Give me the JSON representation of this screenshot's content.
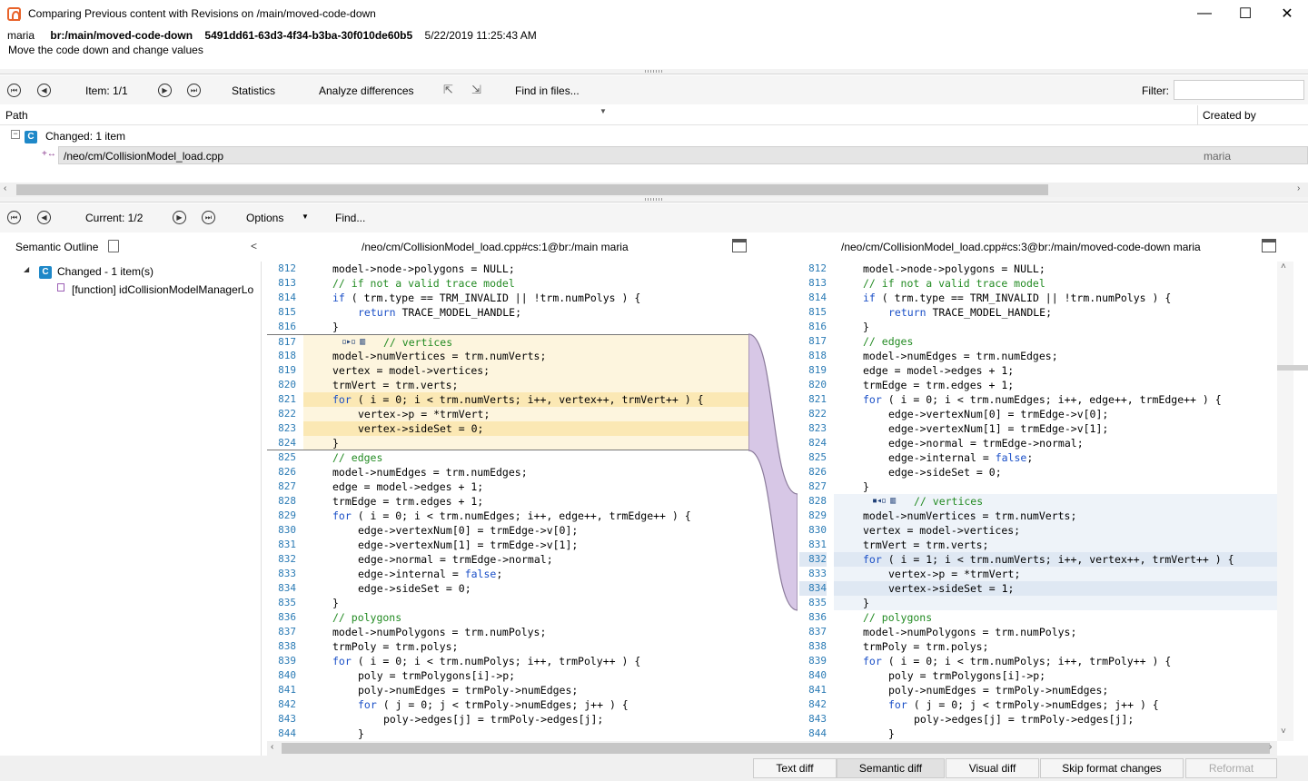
{
  "window": {
    "title": "Comparing Previous content with Revisions on /main/moved-code-down",
    "minimize": "—",
    "maximize": "☐",
    "close": "✕"
  },
  "changeset": {
    "user": "maria",
    "branch": "br:/main/moved-code-down",
    "guid": "5491dd61-63d3-4f34-b3ba-30f010de60b5",
    "date": "5/22/2019 11:25:43 AM",
    "comment": "Move the code down and change values"
  },
  "toolbar1": {
    "item_label": "Item: 1/1",
    "statistics": "Statistics",
    "analyze": "Analyze differences",
    "find_files": "Find in files...",
    "filter_label": "Filter:",
    "filter_value": ""
  },
  "list": {
    "col_path": "Path",
    "col_created": "Created by",
    "group_badge": "C",
    "group_label": "Changed: 1 item",
    "expander": "−",
    "item_icon": "+↔",
    "item_path": "/neo/cm/CollisionModel_load.cpp",
    "item_creator": "maria"
  },
  "toolbar2": {
    "current_label": "Current: 1/2",
    "options": "Options",
    "find": "Find..."
  },
  "outline": {
    "title": "Semantic Outline",
    "collapse": "<",
    "root_badge": "C",
    "root_label": "Changed - 1 item(s)",
    "child_label": "[function] idCollisionModelManagerLo"
  },
  "left_panel": {
    "title": "/neo/cm/CollisionModel_load.cpp#cs:1@br:/main maria"
  },
  "right_panel": {
    "title": "/neo/cm/CollisionModel_load.cpp#cs:3@br:/main/moved-code-down maria"
  },
  "left_code": [
    {
      "n": "812",
      "t": "model->node->polygons = NULL;",
      "i": 0,
      "c": "n"
    },
    {
      "n": "813",
      "t": "// if not a valid trace model",
      "i": 0,
      "c": "c"
    },
    {
      "n": "814",
      "t": "if ( trm.type == TRM_INVALID || !trm.numPolys ) {",
      "i": 0,
      "c": "n"
    },
    {
      "n": "815",
      "t": "return TRACE_MODEL_HANDLE;",
      "i": 1,
      "c": "n"
    },
    {
      "n": "816",
      "t": "}",
      "i": 0,
      "c": "n"
    },
    {
      "n": "817",
      "t": "// vertices",
      "i": 0,
      "c": "c",
      "h": "m"
    },
    {
      "n": "818",
      "t": "model->numVertices = trm.numVerts;",
      "i": 0,
      "c": "n",
      "h": "m"
    },
    {
      "n": "819",
      "t": "vertex = model->vertices;",
      "i": 0,
      "c": "n",
      "h": "m"
    },
    {
      "n": "820",
      "t": "trmVert = trm.verts;",
      "i": 0,
      "c": "n",
      "h": "m"
    },
    {
      "n": "821",
      "t": "for ( i = 0; i < trm.numVerts; i++, vertex++, trmVert++ ) {",
      "i": 0,
      "c": "n",
      "h": "s"
    },
    {
      "n": "822",
      "t": "vertex->p = *trmVert;",
      "i": 1,
      "c": "n",
      "h": "m"
    },
    {
      "n": "823",
      "t": "vertex->sideSet = 0;",
      "i": 1,
      "c": "n",
      "h": "s"
    },
    {
      "n": "824",
      "t": "}",
      "i": 0,
      "c": "n",
      "h": "m"
    },
    {
      "n": "825",
      "t": "// edges",
      "i": 0,
      "c": "c"
    },
    {
      "n": "826",
      "t": "model->numEdges = trm.numEdges;",
      "i": 0,
      "c": "n"
    },
    {
      "n": "827",
      "t": "edge = model->edges + 1;",
      "i": 0,
      "c": "n"
    },
    {
      "n": "828",
      "t": "trmEdge = trm.edges + 1;",
      "i": 0,
      "c": "n"
    },
    {
      "n": "829",
      "t": "for ( i = 0; i < trm.numEdges; i++, edge++, trmEdge++ ) {",
      "i": 0,
      "c": "n"
    },
    {
      "n": "830",
      "t": "edge->vertexNum[0] = trmEdge->v[0];",
      "i": 1,
      "c": "n"
    },
    {
      "n": "831",
      "t": "edge->vertexNum[1] = trmEdge->v[1];",
      "i": 1,
      "c": "n"
    },
    {
      "n": "832",
      "t": "edge->normal = trmEdge->normal;",
      "i": 1,
      "c": "n"
    },
    {
      "n": "833",
      "t": "edge->internal = false;",
      "i": 1,
      "c": "n"
    },
    {
      "n": "834",
      "t": "edge->sideSet = 0;",
      "i": 1,
      "c": "n"
    },
    {
      "n": "835",
      "t": "}",
      "i": 0,
      "c": "n"
    },
    {
      "n": "836",
      "t": "// polygons",
      "i": 0,
      "c": "c"
    },
    {
      "n": "837",
      "t": "model->numPolygons = trm.numPolys;",
      "i": 0,
      "c": "n"
    },
    {
      "n": "838",
      "t": "trmPoly = trm.polys;",
      "i": 0,
      "c": "n"
    },
    {
      "n": "839",
      "t": "for ( i = 0; i < trm.numPolys; i++, trmPoly++ ) {",
      "i": 0,
      "c": "n"
    },
    {
      "n": "840",
      "t": "poly = trmPolygons[i]->p;",
      "i": 1,
      "c": "n"
    },
    {
      "n": "841",
      "t": "poly->numEdges = trmPoly->numEdges;",
      "i": 1,
      "c": "n"
    },
    {
      "n": "842",
      "t": "for ( j = 0; j < trmPoly->numEdges; j++ ) {",
      "i": 1,
      "c": "n"
    },
    {
      "n": "843",
      "t": "poly->edges[j] = trmPoly->edges[j];",
      "i": 2,
      "c": "n"
    },
    {
      "n": "844",
      "t": "}",
      "i": 1,
      "c": "n"
    }
  ],
  "right_code": [
    {
      "n": "812",
      "t": "model->node->polygons = NULL;",
      "i": 0,
      "c": "n"
    },
    {
      "n": "813",
      "t": "// if not a valid trace model",
      "i": 0,
      "c": "c"
    },
    {
      "n": "814",
      "t": "if ( trm.type == TRM_INVALID || !trm.numPolys ) {",
      "i": 0,
      "c": "n"
    },
    {
      "n": "815",
      "t": "return TRACE_MODEL_HANDLE;",
      "i": 1,
      "c": "n"
    },
    {
      "n": "816",
      "t": "}",
      "i": 0,
      "c": "n"
    },
    {
      "n": "817",
      "t": "// edges",
      "i": 0,
      "c": "c"
    },
    {
      "n": "818",
      "t": "model->numEdges = trm.numEdges;",
      "i": 0,
      "c": "n"
    },
    {
      "n": "819",
      "t": "edge = model->edges + 1;",
      "i": 0,
      "c": "n"
    },
    {
      "n": "820",
      "t": "trmEdge = trm.edges + 1;",
      "i": 0,
      "c": "n"
    },
    {
      "n": "821",
      "t": "for ( i = 0; i < trm.numEdges; i++, edge++, trmEdge++ ) {",
      "i": 0,
      "c": "n"
    },
    {
      "n": "822",
      "t": "edge->vertexNum[0] = trmEdge->v[0];",
      "i": 1,
      "c": "n"
    },
    {
      "n": "823",
      "t": "edge->vertexNum[1] = trmEdge->v[1];",
      "i": 1,
      "c": "n"
    },
    {
      "n": "824",
      "t": "edge->normal = trmEdge->normal;",
      "i": 1,
      "c": "n"
    },
    {
      "n": "825",
      "t": "edge->internal = false;",
      "i": 1,
      "c": "n"
    },
    {
      "n": "826",
      "t": "edge->sideSet = 0;",
      "i": 1,
      "c": "n"
    },
    {
      "n": "827",
      "t": "}",
      "i": 0,
      "c": "n"
    },
    {
      "n": "828",
      "t": "// vertices",
      "i": 0,
      "c": "c",
      "h": "m"
    },
    {
      "n": "829",
      "t": "model->numVertices = trm.numVerts;",
      "i": 0,
      "c": "n",
      "h": "m"
    },
    {
      "n": "830",
      "t": "vertex = model->vertices;",
      "i": 0,
      "c": "n",
      "h": "m"
    },
    {
      "n": "831",
      "t": "trmVert = trm.verts;",
      "i": 0,
      "c": "n",
      "h": "m"
    },
    {
      "n": "832",
      "t": "for ( i = 1; i < trm.numVerts; i++, vertex++, trmVert++ ) {",
      "i": 0,
      "c": "n",
      "h": "s"
    },
    {
      "n": "833",
      "t": "vertex->p = *trmVert;",
      "i": 1,
      "c": "n",
      "h": "m"
    },
    {
      "n": "834",
      "t": "vertex->sideSet = 1;",
      "i": 1,
      "c": "n",
      "h": "s"
    },
    {
      "n": "835",
      "t": "}",
      "i": 0,
      "c": "n",
      "h": "m"
    },
    {
      "n": "836",
      "t": "// polygons",
      "i": 0,
      "c": "c"
    },
    {
      "n": "837",
      "t": "model->numPolygons = trm.numPolys;",
      "i": 0,
      "c": "n"
    },
    {
      "n": "838",
      "t": "trmPoly = trm.polys;",
      "i": 0,
      "c": "n"
    },
    {
      "n": "839",
      "t": "for ( i = 0; i < trm.numPolys; i++, trmPoly++ ) {",
      "i": 0,
      "c": "n"
    },
    {
      "n": "840",
      "t": "poly = trmPolygons[i]->p;",
      "i": 1,
      "c": "n"
    },
    {
      "n": "841",
      "t": "poly->numEdges = trmPoly->numEdges;",
      "i": 1,
      "c": "n"
    },
    {
      "n": "842",
      "t": "for ( j = 0; j < trmPoly->numEdges; j++ ) {",
      "i": 1,
      "c": "n"
    },
    {
      "n": "843",
      "t": "poly->edges[j] = trmPoly->edges[j];",
      "i": 2,
      "c": "n"
    },
    {
      "n": "844",
      "t": "}",
      "i": 1,
      "c": "n"
    }
  ],
  "bottom": {
    "text_diff": "Text diff",
    "semantic_diff": "Semantic diff",
    "visual_diff": "Visual diff",
    "skip_format": "Skip format changes",
    "reformat": "Reformat"
  },
  "colors": {
    "left_block": "#fdf5de",
    "left_strong": "#fbe8b4",
    "right_block": "#eef3f9",
    "right_strong": "#dfe8f3",
    "connector": "#d7c7e6"
  }
}
